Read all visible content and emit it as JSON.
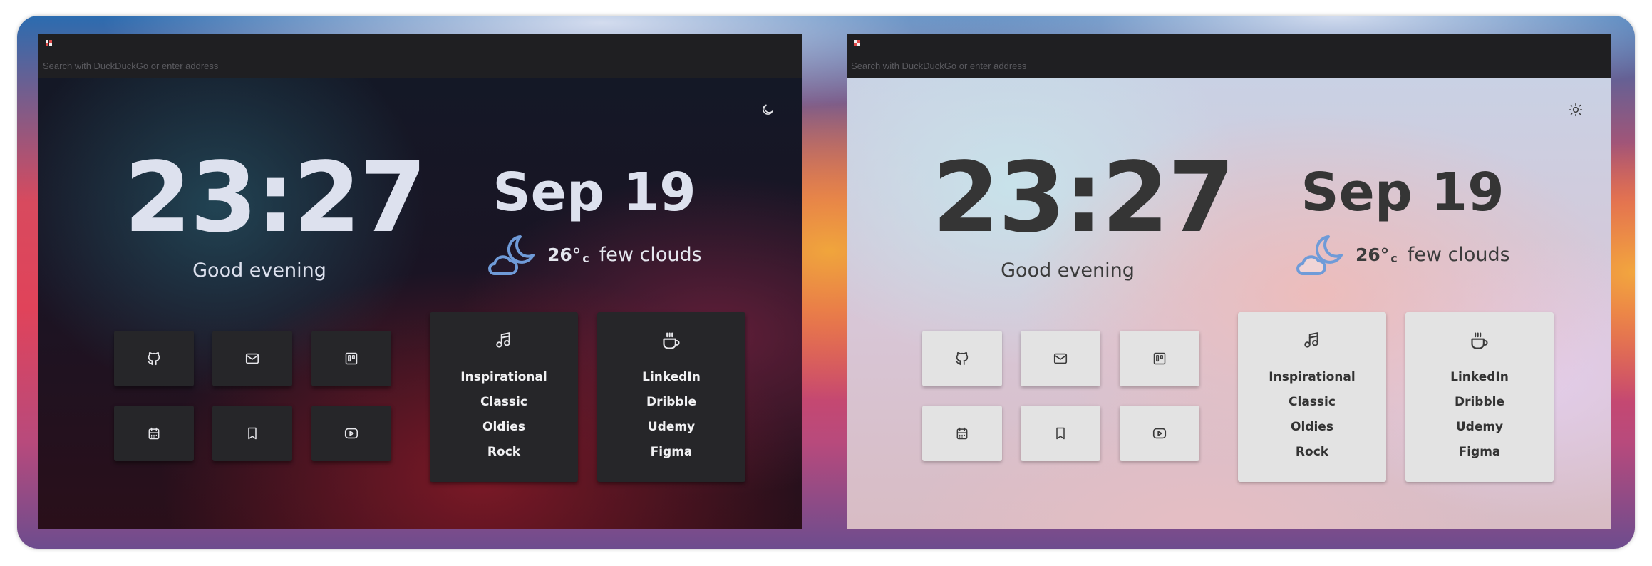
{
  "colors": {
    "dark_surface": "#262629",
    "light_surface": "#e3e3e3",
    "titlebar": "#1f1f22",
    "weather_icon": "#6f9bd8"
  },
  "windows": [
    {
      "theme": "dark",
      "address_placeholder": "Search with DuckDuckGo or enter address",
      "theme_toggle_icon": "moon-icon",
      "clock": "23:27",
      "greeting": "Good evening",
      "date": "Sep 19",
      "weather": {
        "icon": "moon-cloud-icon",
        "temperature": "26°",
        "unit": "c",
        "description": "few clouds"
      },
      "shortcuts": [
        {
          "icon": "github-icon"
        },
        {
          "icon": "mail-icon"
        },
        {
          "icon": "trello-icon"
        },
        {
          "icon": "calendar-icon"
        },
        {
          "icon": "bookmark-icon"
        },
        {
          "icon": "youtube-icon"
        }
      ],
      "music_card": {
        "icon": "music-icon",
        "items": [
          "Inspirational",
          "Classic",
          "Oldies",
          "Rock"
        ]
      },
      "links_card": {
        "icon": "coffee-icon",
        "items": [
          "LinkedIn",
          "Dribble",
          "Udemy",
          "Figma"
        ]
      }
    },
    {
      "theme": "light",
      "address_placeholder": "Search with DuckDuckGo or enter address",
      "theme_toggle_icon": "sun-icon",
      "clock": "23:27",
      "greeting": "Good evening",
      "date": "Sep 19",
      "weather": {
        "icon": "moon-cloud-icon",
        "temperature": "26°",
        "unit": "c",
        "description": "few clouds"
      },
      "shortcuts": [
        {
          "icon": "github-icon"
        },
        {
          "icon": "mail-icon"
        },
        {
          "icon": "trello-icon"
        },
        {
          "icon": "calendar-icon"
        },
        {
          "icon": "bookmark-icon"
        },
        {
          "icon": "youtube-icon"
        }
      ],
      "music_card": {
        "icon": "music-icon",
        "items": [
          "Inspirational",
          "Classic",
          "Oldies",
          "Rock"
        ]
      },
      "links_card": {
        "icon": "coffee-icon",
        "items": [
          "LinkedIn",
          "Dribble",
          "Udemy",
          "Figma"
        ]
      }
    }
  ]
}
